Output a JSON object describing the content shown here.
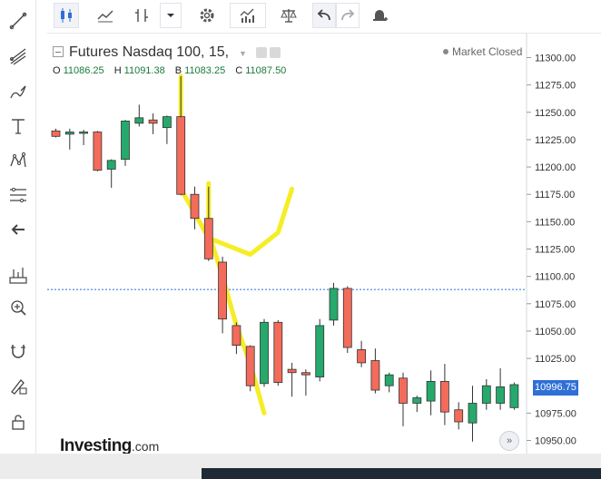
{
  "header": {
    "symbol_title": "Futures Nasdaq 100, 15,",
    "market_status": "Market Closed"
  },
  "ohlc": {
    "open_label": "O",
    "open": "11086.25",
    "high_label": "H",
    "high": "11091.38",
    "low_label": "B",
    "low": "11083.25",
    "close_label": "C",
    "close": "11087.50"
  },
  "brand": {
    "name": "Investing",
    "domain": ".com"
  },
  "scroll_button": "»",
  "left_toolbar": [
    "trendline-icon",
    "pitchfork-icon",
    "brush-icon",
    "text-icon",
    "pattern-icon",
    "fib-icon",
    "back-arrow-icon",
    "measure-icon",
    "zoom-icon",
    "magnet-icon",
    "lock-draw-icon",
    "lock-icon"
  ],
  "top_toolbar": [
    "candle-icon",
    "line-chart-icon",
    "bar-style-icon",
    "dropdown-icon",
    "settings-icon",
    "indicators-icon",
    "compare-icon",
    "undo-icon",
    "redo-icon",
    "alert-icon"
  ],
  "colors": {
    "up": "#26a96c",
    "down": "#f26b5b",
    "highlight": "#f5ea00",
    "price_line": "#2f6fd6"
  },
  "chart_data": {
    "type": "candlestick",
    "ylim": [
      10940,
      11310
    ],
    "y_ticks": [
      11300,
      11275,
      11250,
      11225,
      11200,
      11175,
      11150,
      11125,
      11100,
      11075,
      11050,
      11025,
      11000,
      10975,
      10950
    ],
    "y_tick_labels": [
      "11300.00",
      "11275.00",
      "11250.00",
      "11225.00",
      "11200.00",
      "11175.00",
      "11150.00",
      "11125.00",
      "11100.00",
      "11075.00",
      "11050.00",
      "11025.00",
      "10996.75",
      "10975.00",
      "10950.00"
    ],
    "current_price": "10996.75",
    "reference_line": 11088,
    "candles": [
      {
        "o": 11233,
        "h": 11235,
        "l": 11227,
        "c": 11228
      },
      {
        "o": 11230,
        "h": 11235,
        "l": 11216,
        "c": 11232
      },
      {
        "o": 11232,
        "h": 11234,
        "l": 11220,
        "c": 11232
      },
      {
        "o": 11232,
        "h": 11233,
        "l": 11196,
        "c": 11197
      },
      {
        "o": 11198,
        "h": 11207,
        "l": 11181,
        "c": 11206
      },
      {
        "o": 11207,
        "h": 11243,
        "l": 11201,
        "c": 11242
      },
      {
        "o": 11240,
        "h": 11257,
        "l": 11237,
        "c": 11245
      },
      {
        "o": 11243,
        "h": 11249,
        "l": 11230,
        "c": 11240
      },
      {
        "o": 11236,
        "h": 11247,
        "l": 11221,
        "c": 11246
      },
      {
        "o": 11246,
        "h": 11283,
        "l": 11174,
        "c": 11175
      },
      {
        "o": 11175,
        "h": 11182,
        "l": 11143,
        "c": 11153
      },
      {
        "o": 11153,
        "h": 11182,
        "l": 11114,
        "c": 11116
      },
      {
        "o": 11113,
        "h": 11118,
        "l": 11048,
        "c": 11061
      },
      {
        "o": 11055,
        "h": 11058,
        "l": 11029,
        "c": 11037
      },
      {
        "o": 11036,
        "h": 11037,
        "l": 10995,
        "c": 11000
      },
      {
        "o": 11002,
        "h": 11061,
        "l": 10999,
        "c": 11058
      },
      {
        "o": 11058,
        "h": 11060,
        "l": 11000,
        "c": 11003
      },
      {
        "o": 11015,
        "h": 11021,
        "l": 10990,
        "c": 11012
      },
      {
        "o": 11012,
        "h": 11015,
        "l": 10991,
        "c": 11010
      },
      {
        "o": 11008,
        "h": 11061,
        "l": 11004,
        "c": 11055
      },
      {
        "o": 11060,
        "h": 11094,
        "l": 11055,
        "c": 11089
      },
      {
        "o": 11089,
        "h": 11091,
        "l": 11030,
        "c": 11035
      },
      {
        "o": 11033,
        "h": 11041,
        "l": 11017,
        "c": 11021
      },
      {
        "o": 11023,
        "h": 11034,
        "l": 10993,
        "c": 10996
      },
      {
        "o": 11000,
        "h": 11012,
        "l": 10994,
        "c": 11010
      },
      {
        "o": 11007,
        "h": 11012,
        "l": 10963,
        "c": 10984
      },
      {
        "o": 10984,
        "h": 10991,
        "l": 10976,
        "c": 10989
      },
      {
        "o": 10986,
        "h": 11014,
        "l": 10973,
        "c": 11004
      },
      {
        "o": 11004,
        "h": 11020,
        "l": 10964,
        "c": 10976
      },
      {
        "o": 10978,
        "h": 10985,
        "l": 10960,
        "c": 10967
      },
      {
        "o": 10966,
        "h": 11000,
        "l": 10949,
        "c": 10984
      },
      {
        "o": 10984,
        "h": 11006,
        "l": 10978,
        "c": 11000
      },
      {
        "o": 10984,
        "h": 11016,
        "l": 10978,
        "c": 10999
      },
      {
        "o": 10980,
        "h": 11003,
        "l": 10978,
        "c": 11001
      }
    ]
  }
}
